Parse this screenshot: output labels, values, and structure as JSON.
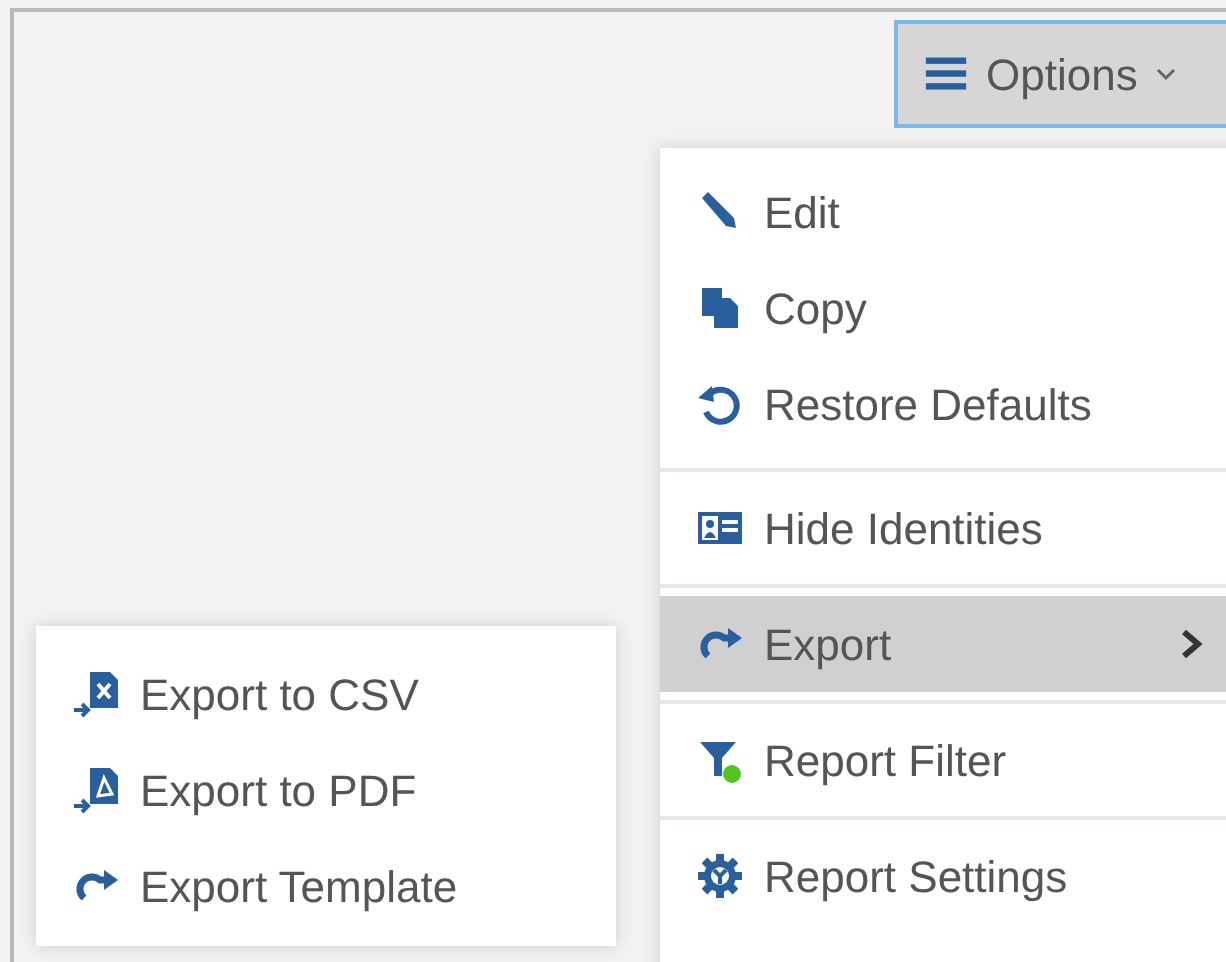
{
  "options_button": {
    "label": "Options"
  },
  "menu": {
    "groups": [
      [
        {
          "label": "Edit",
          "selected": false,
          "submenu": false
        },
        {
          "label": "Copy",
          "selected": false,
          "submenu": false
        },
        {
          "label": "Restore Defaults",
          "selected": false,
          "submenu": false
        }
      ],
      [
        {
          "label": "Hide Identities",
          "selected": false,
          "submenu": false
        }
      ],
      [
        {
          "label": "Export",
          "selected": true,
          "submenu": true
        }
      ],
      [
        {
          "label": "Report Filter",
          "selected": false,
          "submenu": false
        }
      ],
      [
        {
          "label": "Report Settings",
          "selected": false,
          "submenu": false
        }
      ]
    ]
  },
  "submenu": {
    "items": [
      {
        "label": "Export to CSV",
        "selected": false
      },
      {
        "label": "Export to PDF",
        "selected": false
      },
      {
        "label": "Export Template",
        "selected": false
      }
    ]
  }
}
